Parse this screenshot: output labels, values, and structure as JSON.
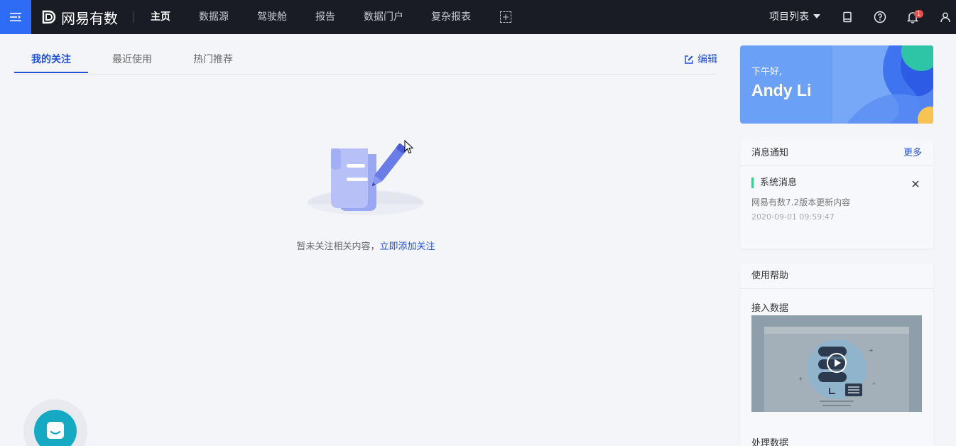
{
  "topbar": {
    "logo_text": "网易有数",
    "nav": [
      {
        "label": "主页",
        "active": true
      },
      {
        "label": "数据源",
        "active": false
      },
      {
        "label": "驾驶舱",
        "active": false
      },
      {
        "label": "报告",
        "active": false
      },
      {
        "label": "数据门户",
        "active": false
      },
      {
        "label": "复杂报表",
        "active": false
      }
    ],
    "project_list": "项目列表",
    "notification_count": "1",
    "icons": [
      "menu-icon",
      "logo-icon",
      "add-icon",
      "book-icon",
      "help-icon",
      "bell-icon",
      "user-icon"
    ]
  },
  "tabs": [
    {
      "label": "我的关注",
      "active": true
    },
    {
      "label": "最近使用",
      "active": false
    },
    {
      "label": "热门推荐",
      "active": false
    }
  ],
  "edit_label": "编辑",
  "empty": {
    "text": "暂未关注相关内容，",
    "link": "立即添加关注"
  },
  "greeting": {
    "small": "下午好,",
    "name": "Andy Li"
  },
  "notices": {
    "title": "消息通知",
    "more": "更多",
    "item": {
      "title": "系统消息",
      "desc": "网易有数7.2版本更新内容",
      "time": "2020-09-01 09:59:47"
    }
  },
  "help": {
    "title": "使用帮助",
    "items": [
      "接入数据",
      "处理数据"
    ]
  },
  "colors": {
    "topbar": "#1a1c25",
    "accent": "#2050d6",
    "menu_btn": "#2f6cf6",
    "chat": "#15a9c4",
    "badge": "#ee4d4d",
    "notice_bar": "#3cc98b"
  }
}
